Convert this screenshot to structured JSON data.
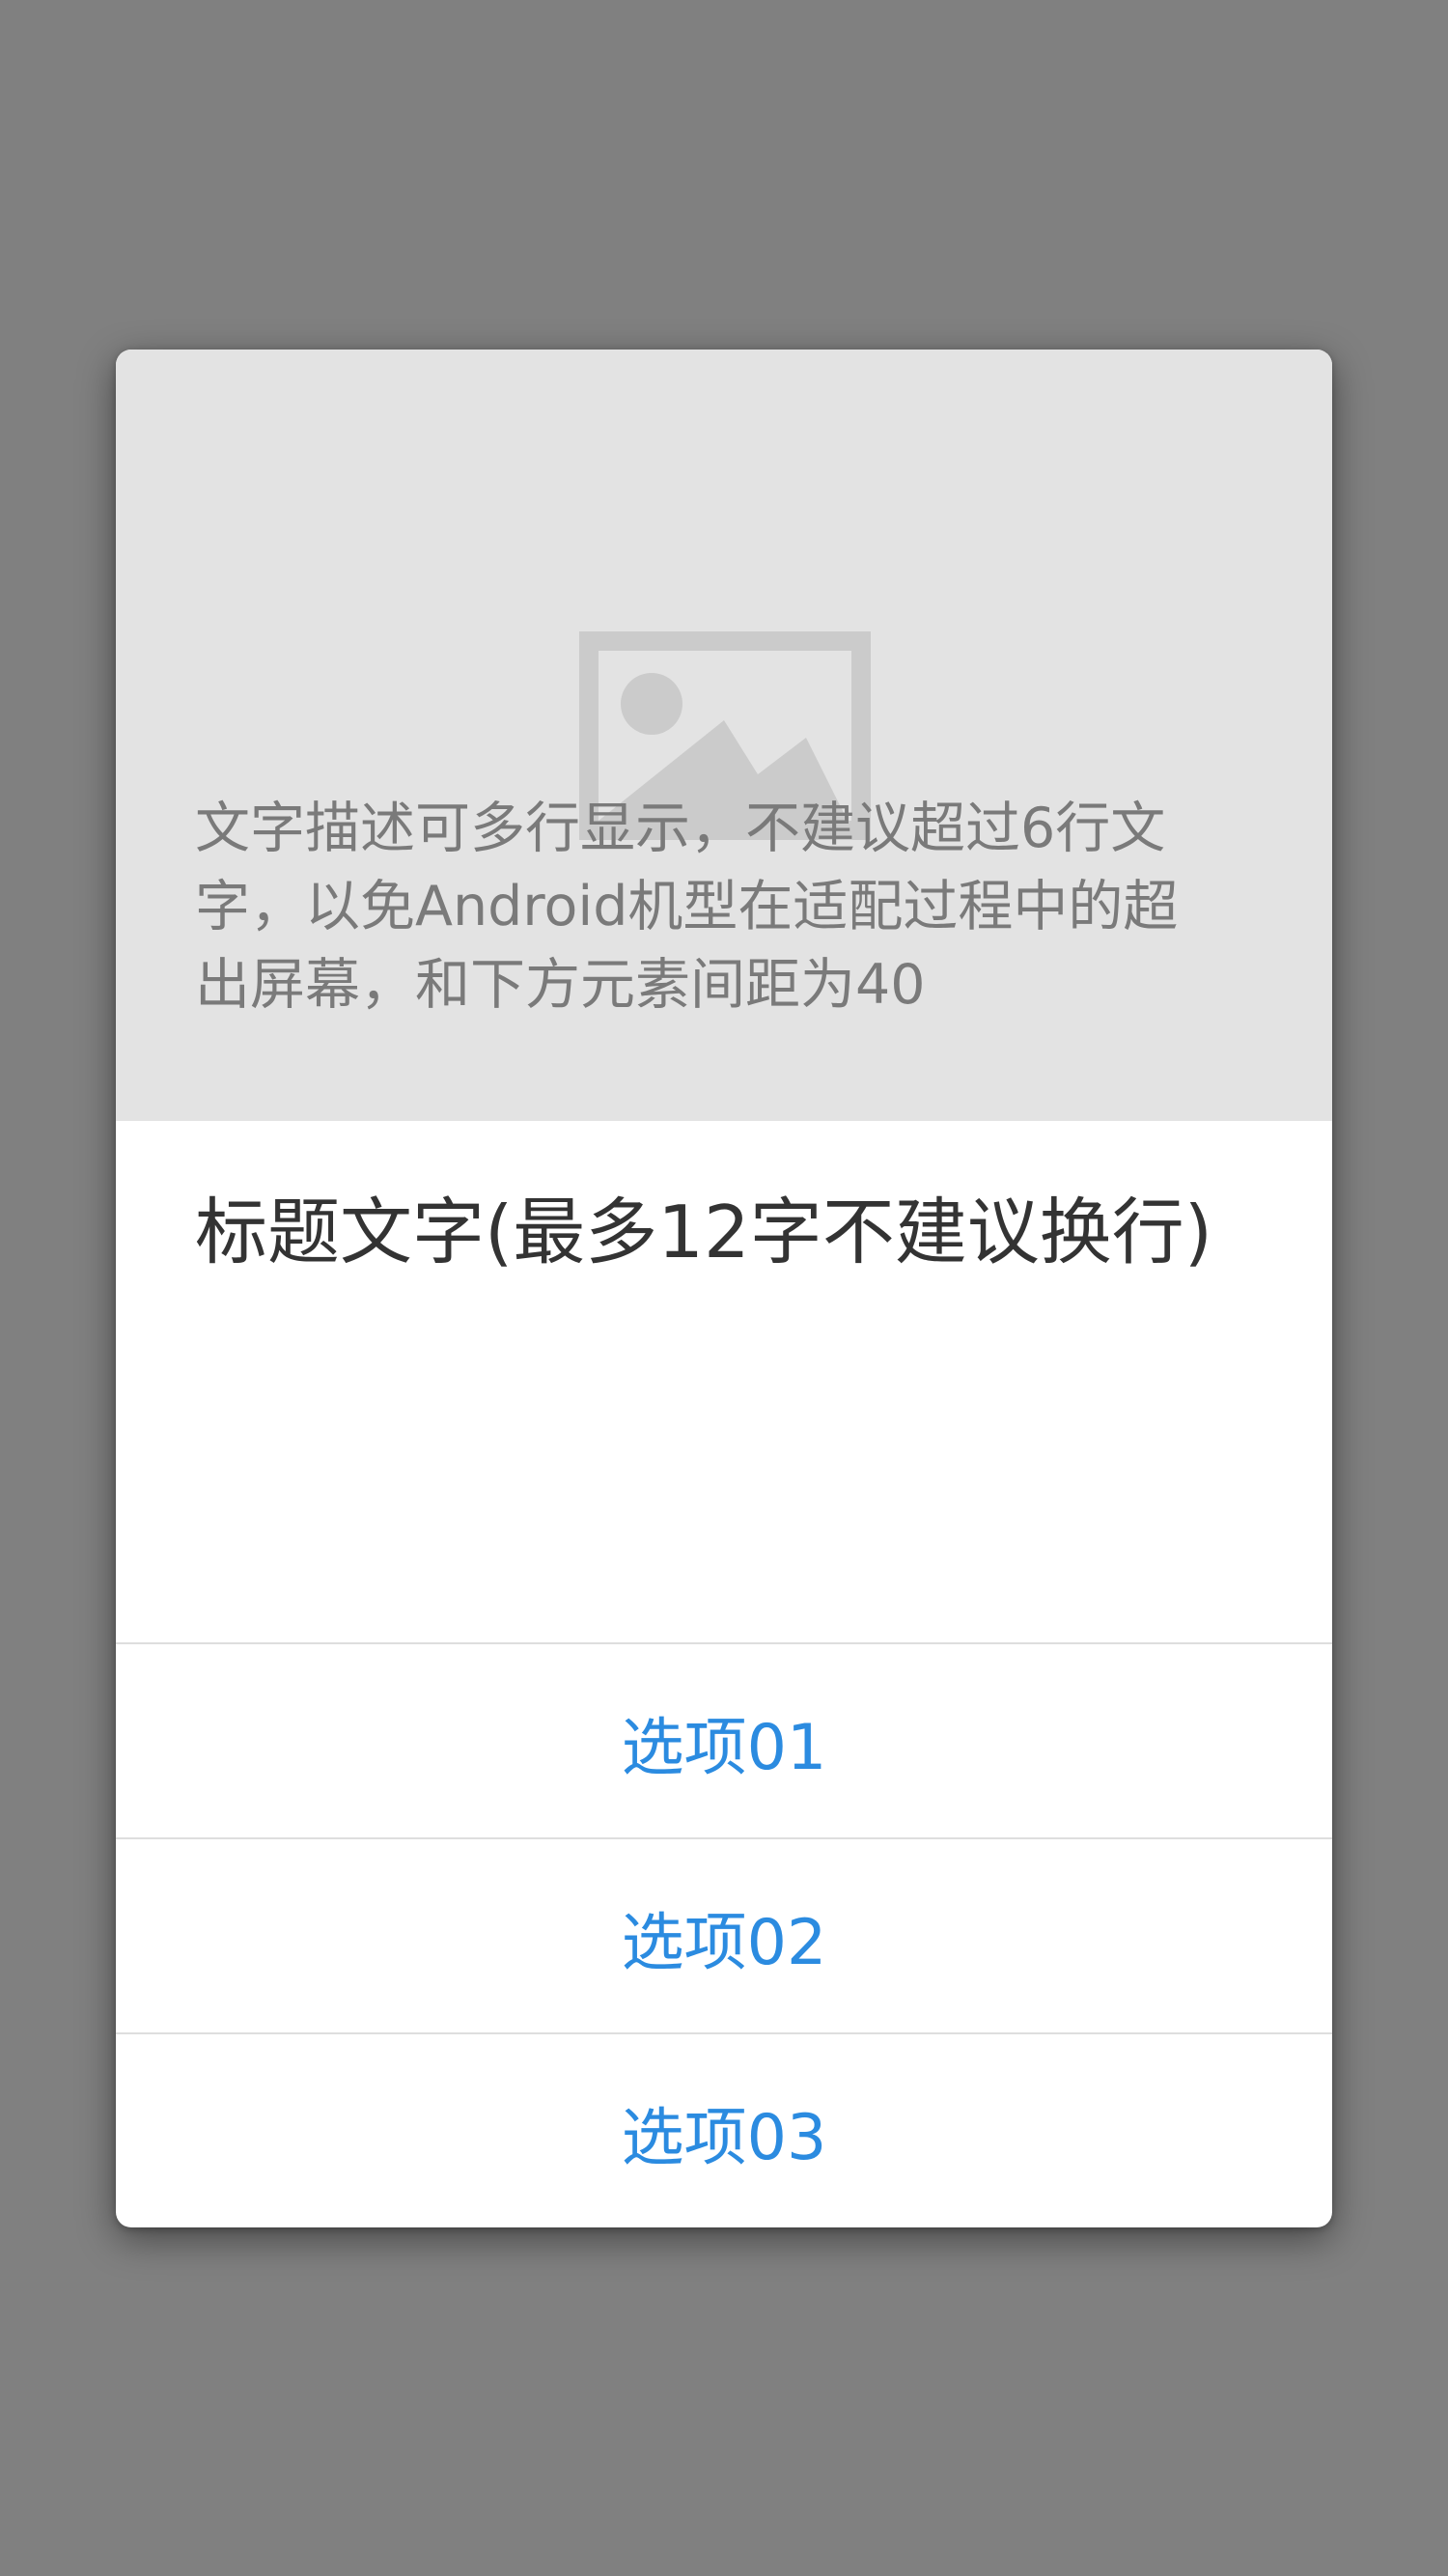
{
  "dialog": {
    "image_placeholder_icon": "image-placeholder-icon",
    "title": "标题文字(最多12字不建议换行)",
    "description_lines": [
      "文字描述可多行显示，不建议超过6行文",
      "字，以免Android机型在适配过程中的超",
      "出屏幕，和下方元素间距为40"
    ],
    "options": [
      {
        "label": "选项01"
      },
      {
        "label": "选项02"
      },
      {
        "label": "选项03"
      }
    ]
  },
  "colors": {
    "overlay": "#808080",
    "dialog_bg": "#ffffff",
    "image_bg": "#e3e3e3",
    "title": "#333333",
    "description": "#7a7a7a",
    "option_text": "#2b8be0",
    "divider": "#dedede"
  }
}
